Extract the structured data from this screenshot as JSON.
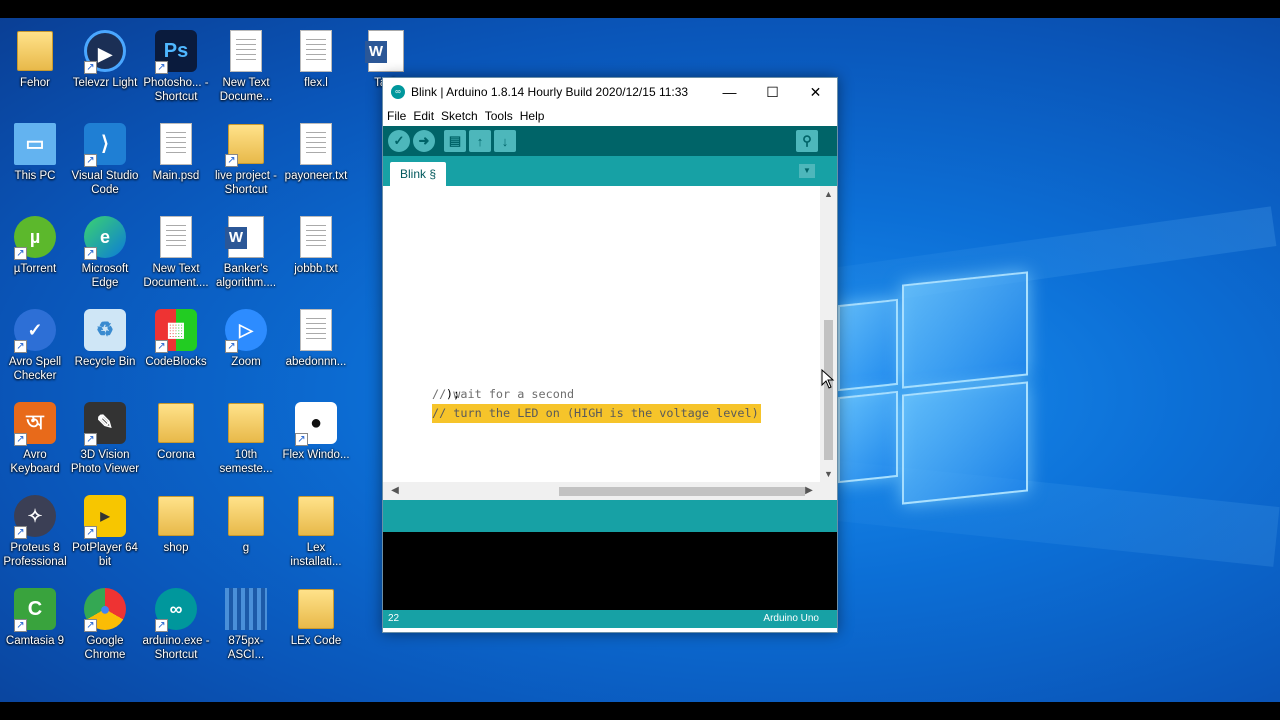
{
  "desktop": {
    "icons": [
      {
        "id": "fehor",
        "label": "Fehor",
        "icon": "folder-icon",
        "x": 0,
        "y": 0
      },
      {
        "id": "televzr",
        "label": "Televzr Light",
        "icon": "televzr-icon"
      },
      {
        "id": "photoshop",
        "label": "Photosho... - Shortcut",
        "icon": "photoshop-icon"
      },
      {
        "id": "newtext1",
        "label": "New Text Docume...",
        "icon": "text-document-icon"
      },
      {
        "id": "flexl",
        "label": "flex.l",
        "icon": "blank-file-icon"
      },
      {
        "id": "task",
        "label": "Task",
        "icon": "word-document-icon"
      },
      {
        "id": "thispc",
        "label": "This PC",
        "icon": "computer-icon"
      },
      {
        "id": "vscode",
        "label": "Visual Studio Code",
        "icon": "vscode-icon"
      },
      {
        "id": "mainpsd",
        "label": "Main.psd",
        "icon": "blank-file-icon"
      },
      {
        "id": "liveproject",
        "label": "live project - Shortcut",
        "icon": "folder-icon"
      },
      {
        "id": "payoneer",
        "label": "payoneer.txt",
        "icon": "text-document-icon"
      },
      {
        "id": "utorrent",
        "label": "µTorrent",
        "icon": "utorrent-icon"
      },
      {
        "id": "edge",
        "label": "Microsoft Edge",
        "icon": "edge-icon"
      },
      {
        "id": "newtext2",
        "label": "New Text Document....",
        "icon": "text-document-icon"
      },
      {
        "id": "bankers",
        "label": "Banker's algorithm....",
        "icon": "word-document-icon"
      },
      {
        "id": "jobbb",
        "label": "jobbb.txt",
        "icon": "text-document-icon"
      },
      {
        "id": "avrospell",
        "label": "Avro Spell Checker",
        "icon": "checkmark-icon"
      },
      {
        "id": "recyclebin",
        "label": "Recycle Bin",
        "icon": "recycle-bin-icon"
      },
      {
        "id": "codeblocks",
        "label": "CodeBlocks",
        "icon": "codeblocks-icon"
      },
      {
        "id": "zoom",
        "label": "Zoom",
        "icon": "zoom-icon"
      },
      {
        "id": "abedonnn",
        "label": "abedonnn...",
        "icon": "text-document-icon"
      },
      {
        "id": "avrokeyboard",
        "label": "Avro Keyboard",
        "icon": "avro-keyboard-icon"
      },
      {
        "id": "3dvision",
        "label": "3D Vision Photo Viewer",
        "icon": "photo-viewer-icon"
      },
      {
        "id": "corona",
        "label": "Corona",
        "icon": "folder-icon"
      },
      {
        "id": "10th",
        "label": "10th semeste...",
        "icon": "folder-icon"
      },
      {
        "id": "flexwindows",
        "label": "Flex Windo...",
        "icon": "apple-icon"
      },
      {
        "id": "proteus",
        "label": "Proteus 8 Professional",
        "icon": "proteus-icon"
      },
      {
        "id": "potplayer",
        "label": "PotPlayer 64 bit",
        "icon": "potplayer-icon"
      },
      {
        "id": "shop",
        "label": "shop",
        "icon": "folder-icon"
      },
      {
        "id": "g",
        "label": "g",
        "icon": "folder-icon"
      },
      {
        "id": "lexinstall",
        "label": "Lex installati...",
        "icon": "folder-icon"
      },
      {
        "id": "camtasia",
        "label": "Camtasia 9",
        "icon": "camtasia-icon"
      },
      {
        "id": "chrome",
        "label": "Google Chrome",
        "icon": "chrome-icon"
      },
      {
        "id": "arduinoexe",
        "label": "arduino.exe - Shortcut",
        "icon": "arduino-icon"
      },
      {
        "id": "875px",
        "label": "875px-ASCI...",
        "icon": "image-icon"
      },
      {
        "id": "lexcode",
        "label": "LEx Code",
        "icon": "folder-icon"
      }
    ]
  },
  "window": {
    "title": "Blink | Arduino 1.8.14 Hourly Build 2020/12/15 11:33",
    "minimize": "—",
    "maximize": "☐",
    "close": "✕",
    "menu": [
      "File",
      "Edit",
      "Sketch",
      "Tools",
      "Help"
    ],
    "toolbar": {
      "verify": "✓",
      "upload": "➜",
      "new": "▤",
      "open": "↑",
      "save": "↓",
      "serial_monitor": "⚲"
    },
    "tab": "Blink §",
    "tab_menu": "▼",
    "code": {
      "line1_prefix": ");",
      "line1_comment": "// turn the LED on (HIGH is the voltage level)",
      "line2_comment": "// wait for a second"
    },
    "status": {
      "line": "22",
      "board": "Arduino Uno"
    }
  }
}
